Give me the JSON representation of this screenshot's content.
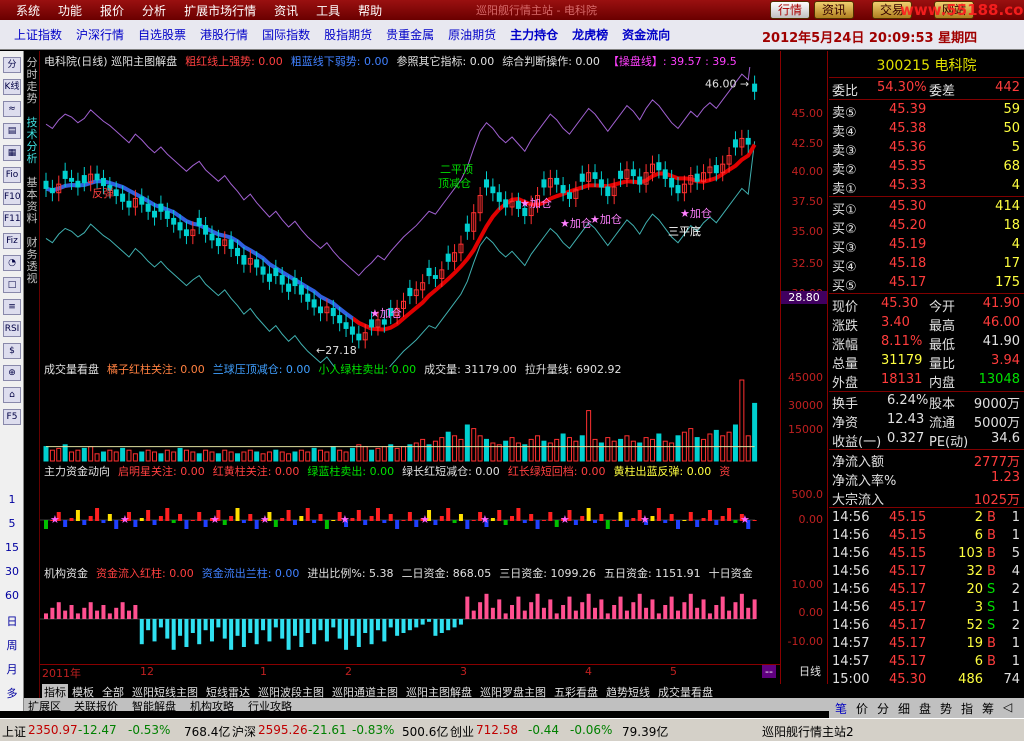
{
  "menu": {
    "items": [
      "系统",
      "功能",
      "报价",
      "分析",
      "扩展市场行情",
      "资讯",
      "工具",
      "帮助"
    ],
    "app_title": "巡阳舰行情主站 - 电科院",
    "right_buttons": [
      "行情",
      "资讯",
      "交易",
      "网站"
    ],
    "url": "www.55188.com"
  },
  "nav": {
    "items": [
      "上证指数",
      "沪深行情",
      "自选股票",
      "港股行情",
      "国际指数",
      "股指期货",
      "贵重金属",
      "原油期货",
      "主力持仓",
      "龙虎榜",
      "资金流向"
    ],
    "date": "2012年5月24日",
    "time": "20:09:53",
    "weekday": "星期四"
  },
  "left_toolbar": [
    "分时",
    "K线",
    "≈",
    "▤",
    "▦",
    "Fio",
    "F10",
    "F11",
    "Fiz",
    "◔",
    "□",
    "≡",
    "RSI",
    "$",
    "⊕",
    "⌂",
    "F5"
  ],
  "period_list": [
    "1",
    "5",
    "15",
    "30",
    "60",
    "日",
    "周",
    "月",
    "多"
  ],
  "vtabs": [
    "分时走势",
    "技术分析",
    "基本资料",
    "财务透视"
  ],
  "main_chart": {
    "header": [
      {
        "text": "电科院(日线) 巡阳主图解盘",
        "color": "#e0e0e0"
      },
      {
        "text": "粗红线上强势: 0.00",
        "color": "#ff4040"
      },
      {
        "text": "粗蓝线下弱势: 0.00",
        "color": "#4080ff"
      },
      {
        "text": "参照其它指标: 0.00",
        "color": "#e0e0e0"
      },
      {
        "text": "综合判断操作: 0.00",
        "color": "#e0e0e0"
      },
      {
        "text": "【操盘线】: 39.57 : 39.5",
        "color": "#ff40ff"
      }
    ],
    "annotations": [
      {
        "text": "46.00",
        "color": "#e0e0e0"
      },
      {
        "text": "27.18",
        "color": "#e0e0e0"
      },
      {
        "text": "二平顶",
        "color": "#00e000"
      },
      {
        "text": "顶减仓",
        "color": "#00e000"
      },
      {
        "text": "加仓",
        "color": "#ff80ff"
      },
      {
        "text": "三平底",
        "color": "#ffffff"
      },
      {
        "text": "反弹",
        "color": "#ff4040"
      }
    ]
  },
  "volume_panel": {
    "header": [
      {
        "text": "成交量看盘",
        "color": "#e0e0e0"
      },
      {
        "text": "橘子红柱关注: 0.00",
        "color": "#ff8040"
      },
      {
        "text": "兰球压顶减仓: 0.00",
        "color": "#40a0ff"
      },
      {
        "text": "小人绿柱卖出: 0.00",
        "color": "#00e000"
      },
      {
        "text": "成交量: 31179.00",
        "color": "#e0e0e0"
      },
      {
        "text": "拉升量线: 6902.92",
        "color": "#e0e0e0"
      }
    ]
  },
  "fund_panel": {
    "header": [
      {
        "text": "主力资金动向",
        "color": "#e0e0e0"
      },
      {
        "text": "启明星关注: 0.00",
        "color": "#ff4040"
      },
      {
        "text": "红黄柱关注: 0.00",
        "color": "#ff4040"
      },
      {
        "text": "绿蓝柱卖出: 0.00",
        "color": "#00e000"
      },
      {
        "text": "绿长红短减仓: 0.00",
        "color": "#e0e0e0"
      },
      {
        "text": "红长绿短回档: 0.00",
        "color": "#ff4040"
      },
      {
        "text": "黄柱出蓝反弹: 0.00",
        "color": "#ffff40"
      },
      {
        "text": "资",
        "color": "#ff4040"
      }
    ]
  },
  "inst_panel": {
    "header": [
      {
        "text": "机构资金",
        "color": "#e0e0e0"
      },
      {
        "text": "资金流入红柱: 0.00",
        "color": "#ff4040"
      },
      {
        "text": "资金流出兰柱: 0.00",
        "color": "#4080ff"
      },
      {
        "text": "进出比例%: 5.38",
        "color": "#e0e0e0"
      },
      {
        "text": "二日资金: 868.05",
        "color": "#e0e0e0"
      },
      {
        "text": "三日资金: 1099.26",
        "color": "#e0e0e0"
      },
      {
        "text": "五日资金: 1151.91",
        "color": "#e0e0e0"
      },
      {
        "text": "十日资金",
        "color": "#e0e0e0"
      }
    ]
  },
  "price_axis": [
    "45.00",
    "42.50",
    "40.00",
    "37.50",
    "35.00",
    "32.50",
    "30.00"
  ],
  "current_price_tag": "28.80",
  "volume_axis": [
    "45000",
    "30000",
    "15000"
  ],
  "fund_axis": [
    "500.0",
    "0.00"
  ],
  "inst_axis": [
    "10.00",
    "0.00",
    "-10.00"
  ],
  "x_axis": [
    "2011年",
    "12",
    "1",
    "2",
    "3",
    "4",
    "5"
  ],
  "period_label": "日线",
  "quote": {
    "code_name": "300215 电科院",
    "weibi_label": "委比",
    "weibi": "54.30%",
    "weicha_label": "委差",
    "weicha": "442",
    "sell": [
      {
        "label": "卖⑤",
        "price": "45.39",
        "vol": "59"
      },
      {
        "label": "卖④",
        "price": "45.38",
        "vol": "50"
      },
      {
        "label": "卖③",
        "price": "45.36",
        "vol": "5"
      },
      {
        "label": "卖②",
        "price": "45.35",
        "vol": "68"
      },
      {
        "label": "卖①",
        "price": "45.33",
        "vol": "4"
      }
    ],
    "buy": [
      {
        "label": "买①",
        "price": "45.30",
        "vol": "414"
      },
      {
        "label": "买②",
        "price": "45.20",
        "vol": "18"
      },
      {
        "label": "买③",
        "price": "45.19",
        "vol": "4"
      },
      {
        "label": "买④",
        "price": "45.18",
        "vol": "17"
      },
      {
        "label": "买⑤",
        "price": "45.17",
        "vol": "175"
      }
    ],
    "stats": [
      {
        "l1": "现价",
        "v1": "45.30",
        "c1": "red",
        "l2": "今开",
        "v2": "41.90",
        "c2": "red"
      },
      {
        "l1": "涨跌",
        "v1": "3.40",
        "c1": "red",
        "l2": "最高",
        "v2": "46.00",
        "c2": "red"
      },
      {
        "l1": "涨幅",
        "v1": "8.11%",
        "c1": "red",
        "l2": "最低",
        "v2": "41.90",
        "c2": "wht"
      },
      {
        "l1": "总量",
        "v1": "31179",
        "c1": "yel",
        "l2": "量比",
        "v2": "3.94",
        "c2": "red"
      },
      {
        "l1": "外盘",
        "v1": "18131",
        "c1": "red",
        "l2": "内盘",
        "v2": "13048",
        "c2": "grn"
      }
    ],
    "stats2": [
      {
        "l1": "换手",
        "v1": "6.24%",
        "c1": "wht",
        "l2": "股本",
        "v2": "9000万",
        "c2": "wht"
      },
      {
        "l1": "净资",
        "v1": "12.43",
        "c1": "wht",
        "l2": "流通",
        "v2": "5000万",
        "c2": "wht"
      },
      {
        "l1": "收益(一)",
        "v1": "0.327",
        "c1": "wht",
        "l2": "PE(动)",
        "v2": "34.6",
        "c2": "wht"
      }
    ],
    "flows": [
      {
        "label": "净流入额",
        "value": "2777万",
        "color": "red"
      },
      {
        "label": "净流入率%",
        "value": "1.23",
        "color": "red"
      },
      {
        "label": "大宗流入",
        "value": "1025万",
        "color": "red"
      }
    ],
    "ticks": [
      {
        "time": "14:56",
        "price": "45.15",
        "vol": "2",
        "bs": "B",
        "n": "1"
      },
      {
        "time": "14:56",
        "price": "45.15",
        "vol": "6",
        "bs": "B",
        "n": "1"
      },
      {
        "time": "14:56",
        "price": "45.15",
        "vol": "103",
        "bs": "B",
        "n": "5"
      },
      {
        "time": "14:56",
        "price": "45.17",
        "vol": "32",
        "bs": "B",
        "n": "4"
      },
      {
        "time": "14:56",
        "price": "45.17",
        "vol": "20",
        "bs": "S",
        "n": "2"
      },
      {
        "time": "14:56",
        "price": "45.17",
        "vol": "3",
        "bs": "S",
        "n": "1"
      },
      {
        "time": "14:56",
        "price": "45.17",
        "vol": "52",
        "bs": "S",
        "n": "2"
      },
      {
        "time": "14:57",
        "price": "45.17",
        "vol": "19",
        "bs": "B",
        "n": "1"
      },
      {
        "time": "14:57",
        "price": "45.17",
        "vol": "6",
        "bs": "B",
        "n": "1"
      },
      {
        "time": "15:00",
        "price": "45.30",
        "vol": "486",
        "bs": "",
        "n": "74"
      }
    ],
    "tabs": [
      "笔",
      "价",
      "分",
      "细",
      "盘",
      "势",
      "指",
      "筹",
      "◁"
    ]
  },
  "bottom_tabs": [
    "指标",
    "模板",
    "全部",
    "巡阳短线主图",
    "短线雷达",
    "巡阳波段主图",
    "巡阳通道主图",
    "巡阳主图解盘",
    "巡阳罗盘主图",
    "五彩看盘",
    "趋势短线",
    "成交量看盘"
  ],
  "bottom_tabs2": [
    "扩展区",
    "关联报价",
    "智能解盘",
    "机构攻略",
    "行业攻略"
  ],
  "status": {
    "sh_label": "上证",
    "sh_val": "2350.97",
    "sh_chg": "-12.47",
    "sh_pct": "-0.53%",
    "sh_amt": "768.4亿",
    "sz_label": "沪深",
    "sz_val": "2595.26",
    "sz_chg": "-21.61",
    "sz_pct": "-0.83%",
    "sz_amt": "500.6亿",
    "cy_label": "创业",
    "cy_val": "712.58",
    "cy_chg": "-0.44",
    "cy_pct": "-0.06%",
    "cy_amt": "79.39亿",
    "station": "巡阳舰行情主站2"
  },
  "chart_data": {
    "type": "candlestick",
    "title": "电科院(日线)",
    "ylim": [
      26,
      47
    ],
    "high_label": 46.0,
    "low_label": 27.18,
    "closes": [
      38.5,
      38.2,
      38.8,
      39.2,
      39.0,
      38.6,
      38.9,
      39.5,
      39.1,
      38.7,
      38.4,
      38.0,
      37.6,
      37.2,
      37.8,
      37.4,
      36.9,
      36.5,
      36.9,
      36.4,
      36.0,
      35.6,
      35.2,
      35.6,
      35.9,
      35.3,
      34.9,
      34.5,
      34.9,
      34.3,
      33.8,
      33.2,
      33.6,
      33.0,
      32.5,
      32.0,
      32.4,
      31.8,
      31.3,
      31.7,
      31.1,
      30.6,
      30.2,
      29.8,
      30.2,
      29.6,
      29.1,
      28.7,
      28.3,
      27.9,
      28.4,
      28.8,
      29.3,
      29.0,
      29.6,
      30.1,
      30.6,
      31.0,
      31.4,
      31.9,
      32.4,
      32.2,
      32.8,
      33.4,
      34.0,
      34.6,
      35.5,
      36.8,
      38.0,
      38.6,
      38.2,
      37.6,
      37.2,
      37.6,
      37.1,
      36.6,
      37.4,
      38.0,
      38.6,
      39.2,
      38.8,
      38.2,
      37.8,
      38.4,
      39.0,
      39.6,
      39.2,
      38.6,
      38.0,
      38.6,
      39.2,
      39.8,
      39.4,
      38.8,
      39.6,
      40.2,
      39.8,
      39.2,
      38.6,
      38.2,
      38.8,
      39.4,
      39.0,
      39.6,
      40.0,
      39.6,
      40.2,
      40.8,
      41.4,
      42.0,
      41.6,
      45.3
    ]
  }
}
